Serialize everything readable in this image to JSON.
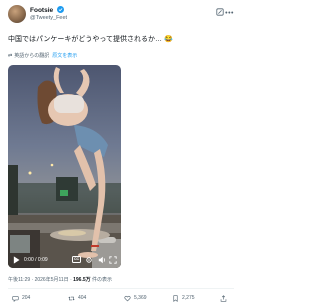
{
  "author": {
    "display_name": "Footsie",
    "handle": "@Tweety_Feet"
  },
  "tweet": {
    "text": "中国ではパンケーキがどうやって提供されるか… 😂",
    "translation_note": "英語からの翻訳",
    "show_original": "原文を表示"
  },
  "video": {
    "time": "0:00 / 0:09"
  },
  "meta": {
    "timestamp": "午後11:29 · 2026年5月11日 · ",
    "views_count": "196.5万",
    "views_suffix": " 件の表示"
  },
  "actions": {
    "reply_count": "204",
    "retweet_count": "404",
    "like_count": "5,369",
    "bookmark_count": "2,275"
  },
  "colors": {
    "accent": "#1d9bf0",
    "text": "#0f1419",
    "secondary": "#536471"
  }
}
